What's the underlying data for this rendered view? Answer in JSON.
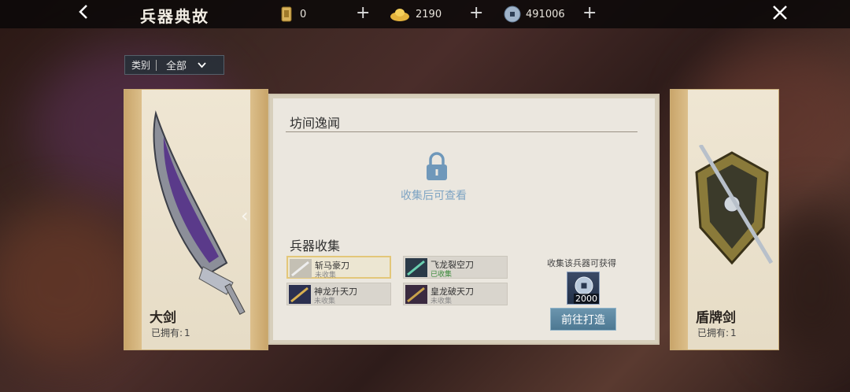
{
  "header": {
    "title": "兵器典故",
    "resources": [
      {
        "icon": "token-icon",
        "value": "0"
      },
      {
        "icon": "gold-ingot-icon",
        "value": "2190"
      },
      {
        "icon": "coin-icon",
        "value": "491006"
      }
    ]
  },
  "filter": {
    "label": "类别",
    "value": "全部"
  },
  "left_card": {
    "name": "大剑",
    "owned_label": "已拥有:",
    "owned_count": "1"
  },
  "right_card": {
    "name": "盾牌剑",
    "owned_label": "已拥有:",
    "owned_count": "1"
  },
  "panel": {
    "lore_title": "坊间逸闻",
    "locked_text": "收集后可查看",
    "collection_title": "兵器收集",
    "items": [
      {
        "name": "斩马豪刀",
        "status": "未收集",
        "selected": true
      },
      {
        "name": "飞龙裂空刀",
        "status": "已收集",
        "selected": false
      },
      {
        "name": "神龙升天刀",
        "status": "未收集",
        "selected": false
      },
      {
        "name": "皇龙破天刀",
        "status": "未收集",
        "selected": false
      }
    ],
    "reward_label": "收集该兵器可获得",
    "reward_count": "2000",
    "forge_button": "前往打造"
  },
  "colors": {
    "accent_button": "#5a86a0",
    "collected_status": "#3a8a3a",
    "locked_text": "#7ea4c3"
  }
}
